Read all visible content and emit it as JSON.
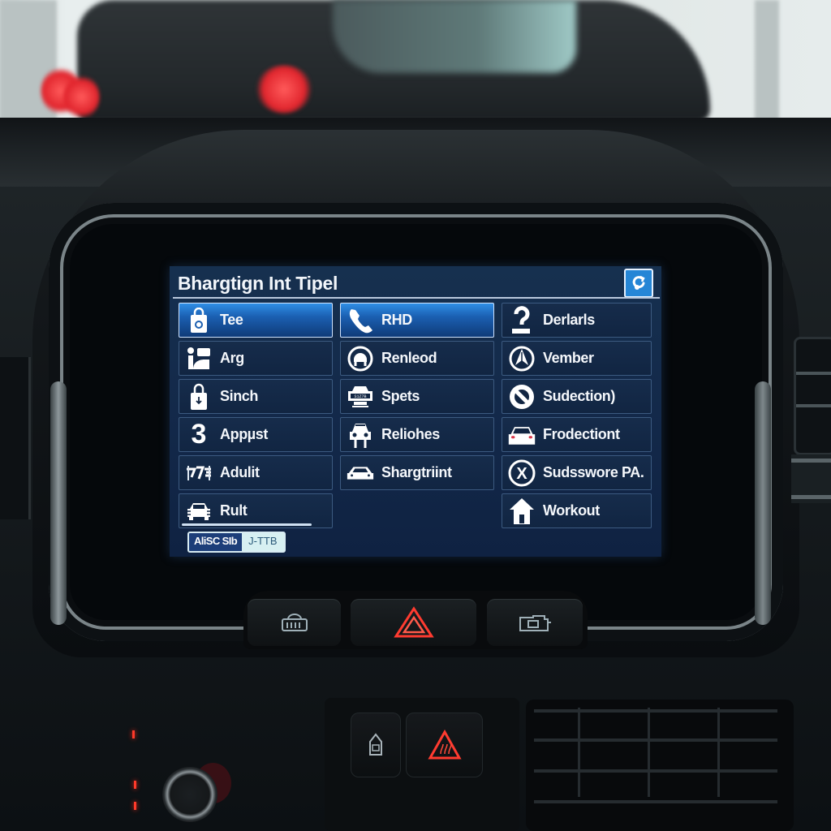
{
  "screen": {
    "title": "Bhargtign Int Tipel",
    "corner_button_icon": "refresh-settings-icon",
    "columns": [
      [
        {
          "label": "Tee",
          "icon": "shopping-bag-icon",
          "active": true
        },
        {
          "label": "Arg",
          "icon": "passenger-icon",
          "active": false
        },
        {
          "label": "Sinch",
          "icon": "lock-download-icon",
          "active": false
        },
        {
          "label": "Appµst",
          "icon": "number-3-icon",
          "active": false
        },
        {
          "label": "Adulit",
          "icon": "glitch-icon",
          "active": false
        },
        {
          "label": "Rult",
          "icon": "car-front-icon",
          "active": false
        }
      ],
      [
        {
          "label": "RHD",
          "icon": "phone-icon",
          "active": true
        },
        {
          "label": "Renleod",
          "icon": "seat-circle-icon",
          "active": false
        },
        {
          "label": "Spets",
          "icon": "vehicle-plate-icon",
          "active": false
        },
        {
          "label": "Reliohes",
          "icon": "car-lift-icon",
          "active": false
        },
        {
          "label": "Shargtriint",
          "icon": "car-icon",
          "active": false
        }
      ],
      [
        {
          "label": "Derlarls",
          "icon": "question-icon",
          "active": false
        },
        {
          "label": "Vember",
          "icon": "navigation-arrow-icon",
          "active": false
        },
        {
          "label": "Sudection)",
          "icon": "prohibited-icon",
          "active": false
        },
        {
          "label": "Frodectiont",
          "icon": "car-rear-icon",
          "active": false
        },
        {
          "label": "Sudsswore PA.",
          "icon": "close-circle-icon",
          "active": false
        },
        {
          "label": "Workout",
          "icon": "home-icon",
          "active": false
        }
      ]
    ],
    "badge": {
      "left": "AliSC SIb",
      "right": "J-TTB"
    },
    "colors": {
      "accent": "#2586d6",
      "background": "#13294a",
      "tile_border": "#3c5a80"
    }
  },
  "physical_buttons": {
    "upper": [
      {
        "name": "seat-heater-button",
        "icon": "radiator-icon"
      },
      {
        "name": "hazard-button",
        "icon": "hazard-triangle-icon"
      },
      {
        "name": "engine-button",
        "icon": "engine-check-icon"
      }
    ],
    "lower": [
      {
        "name": "lock-button",
        "icon": "tag-icon"
      },
      {
        "name": "hazard-lower-button",
        "icon": "hazard-triangle-icon"
      }
    ],
    "hazard_color": "#ff3b30"
  }
}
